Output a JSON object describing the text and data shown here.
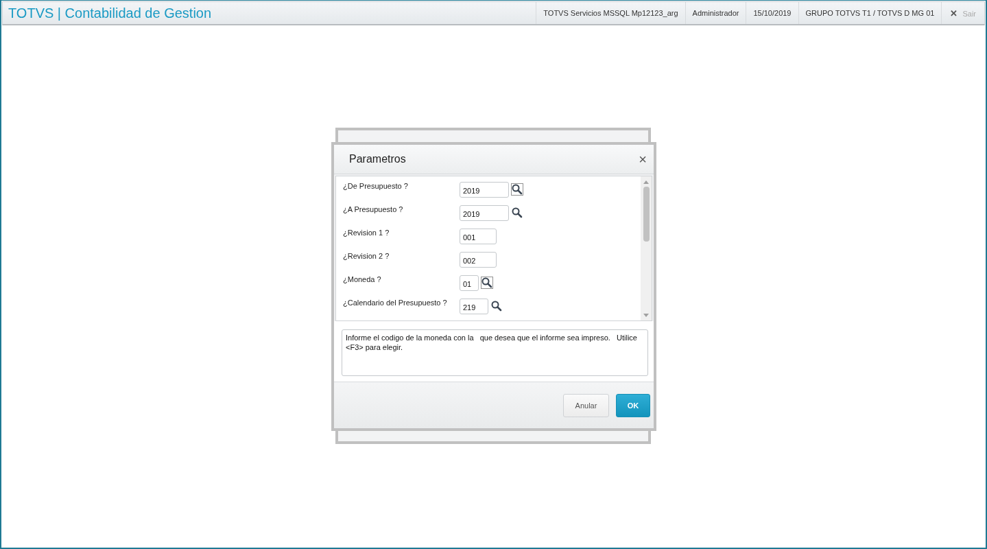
{
  "header": {
    "title": "TOTVS | Contabilidad de Gestion",
    "info": [
      "TOTVS Servicios MSSQL Mp12123_arg",
      "Administrador",
      "15/10/2019",
      "GRUPO TOTVS T1 / TOTVS D MG 01"
    ],
    "exit": {
      "icon": "✕",
      "label": "Sair"
    }
  },
  "dialog": {
    "title": "Parametros",
    "close": "×",
    "params": [
      {
        "label": "¿De Presupuesto ?",
        "value": "2019",
        "lookup": true,
        "focused": true
      },
      {
        "label": "¿A Presupuesto ?",
        "value": "2019",
        "lookup": true,
        "focused": false
      },
      {
        "label": "¿Revision 1 ?",
        "value": "001",
        "lookup": false
      },
      {
        "label": "¿Revision 2 ?",
        "value": "002",
        "lookup": false
      },
      {
        "label": "¿Moneda ?",
        "value": "01",
        "lookup": true,
        "focused": true
      },
      {
        "label": "¿Calendario del Presupuesto ?",
        "value": "219",
        "lookup": true,
        "focused": false
      }
    ],
    "help": "Informe el codigo de la moneda con la   que desea que el informe sea impreso.   Utilice <F3> para elegir.",
    "buttons": [
      {
        "label": "Anular",
        "kind": "secondary"
      },
      {
        "label": "OK",
        "kind": "primary"
      }
    ]
  }
}
